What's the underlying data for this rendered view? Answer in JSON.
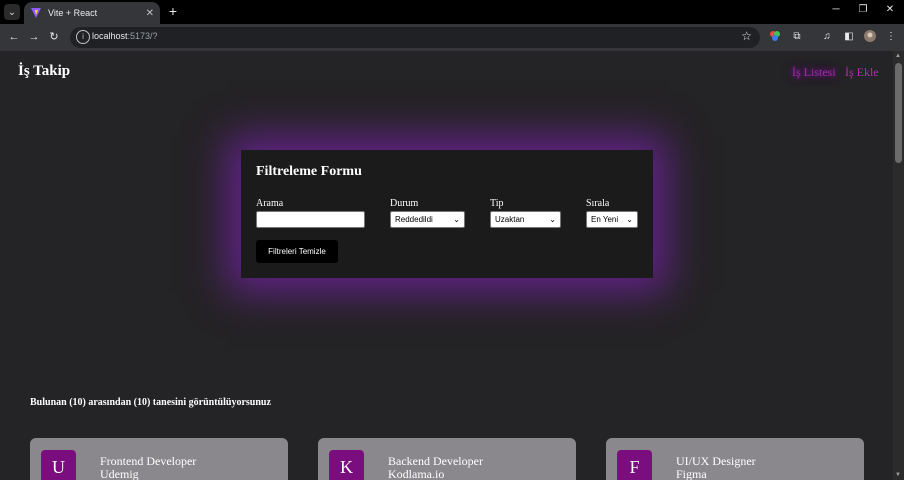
{
  "browser": {
    "tab_title": "Vite + React",
    "url_host": "localhost",
    "url_path": ":5173/?",
    "new_tab": "+",
    "tab_close": "✕"
  },
  "app": {
    "brand": "İş Takip",
    "nav": [
      "İş Listesi",
      "İş Ekle"
    ]
  },
  "filter": {
    "title": "Filtreleme Formu",
    "fields": [
      {
        "label": "Arama",
        "value": ""
      },
      {
        "label": "Durum",
        "value": "Reddedildi"
      },
      {
        "label": "Tip",
        "value": "Uzaktan"
      },
      {
        "label": "Sırala",
        "value": "En Yeni"
      }
    ],
    "clear_label": "Filtreleri Temizle"
  },
  "results": {
    "summary": "Bulunan (10) arasından (10) tanesini görüntülüyorsunuz"
  },
  "jobs": [
    {
      "letter": "U",
      "title": "Frontend Developer",
      "company": "Udemig"
    },
    {
      "letter": "K",
      "title": "Backend Developer",
      "company": "Kodlama.io"
    },
    {
      "letter": "F",
      "title": "UI/UX Designer",
      "company": "Figma"
    }
  ],
  "colors": {
    "accent_purple": "#7a0e7e",
    "nav_link": "#b82ab8",
    "glow": "#7823aa"
  }
}
